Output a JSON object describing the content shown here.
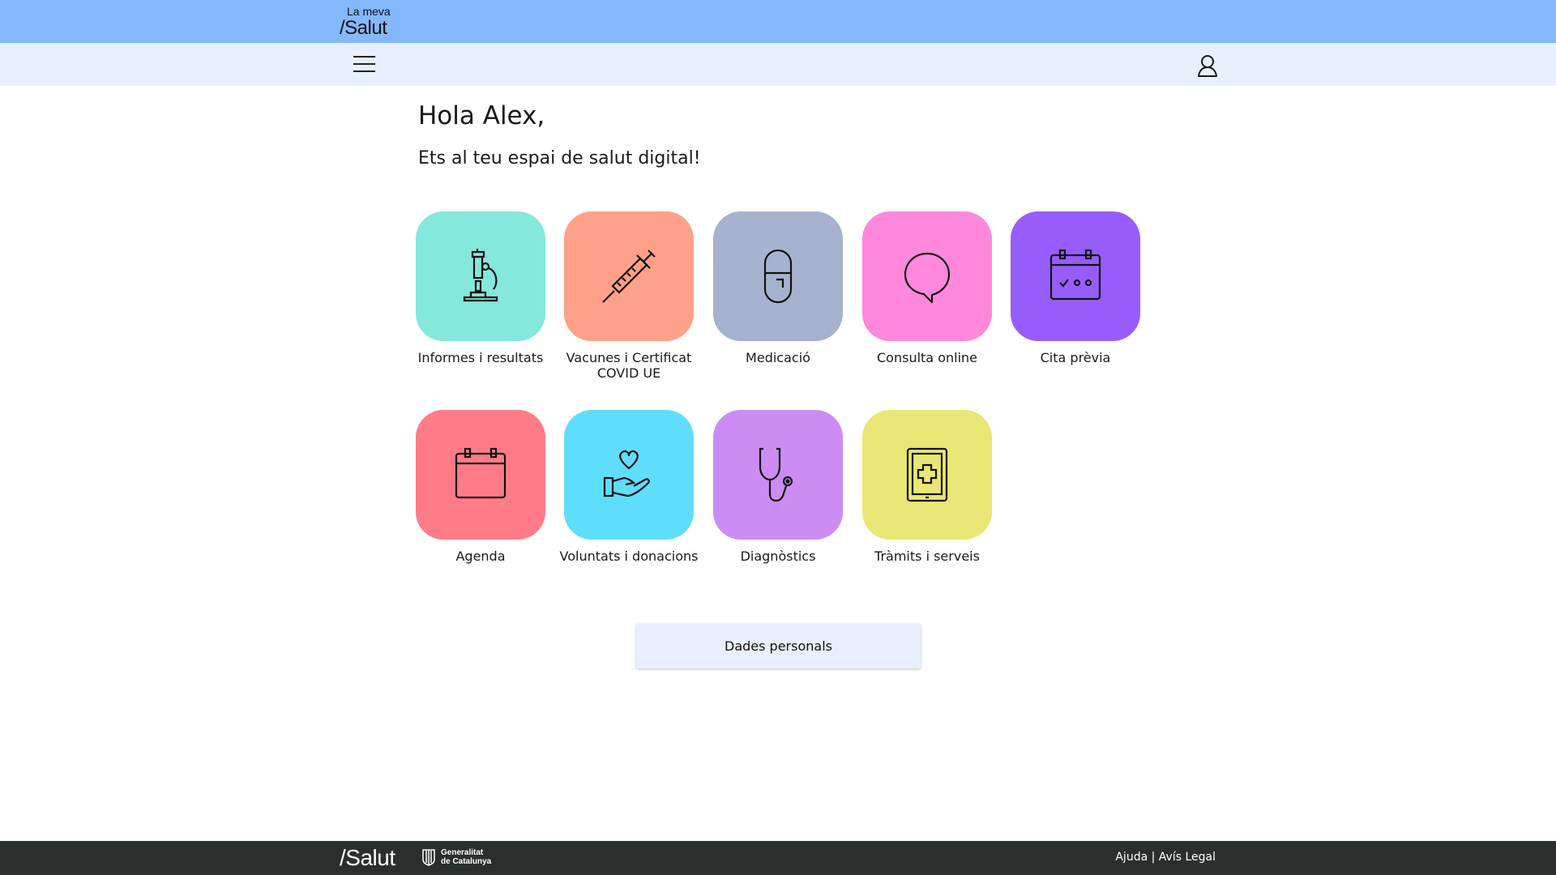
{
  "colors": {
    "top_bar": "#84b8fb",
    "nav_bar": "#e6f0fe",
    "footer": "#2a2f2e",
    "button": "#e9effc"
  },
  "header": {
    "logo_small": "La meva",
    "logo_big": "/Salut",
    "menu_icon": "hamburger-menu-icon",
    "user_icon": "user-icon"
  },
  "main": {
    "greeting": "Hola Alex,",
    "subtitle": "Ets al teu espai de salut digital!",
    "tiles": [
      {
        "label": "Informes i resultats",
        "color": "#84e8da",
        "icon": "microscope-icon"
      },
      {
        "label": "Vacunes i Certificat COVID UE",
        "color": "#ffa188",
        "icon": "syringe-icon"
      },
      {
        "label": "Medicació",
        "color": "#a7b2ce",
        "icon": "pill-icon"
      },
      {
        "label": "Consulta online",
        "color": "#ff88dc",
        "icon": "chat-bubble-icon"
      },
      {
        "label": "Cita prèvia",
        "color": "#965dfb",
        "icon": "calendar-check-icon"
      },
      {
        "label": "Agenda",
        "color": "#ff7b88",
        "icon": "calendar-icon"
      },
      {
        "label": "Voluntats i donacions",
        "color": "#5fdefc",
        "icon": "hand-heart-icon"
      },
      {
        "label": "Diagnòstics",
        "color": "#cd8cf3",
        "icon": "stethoscope-icon"
      },
      {
        "label": "Tràmits i serveis",
        "color": "#e9e775",
        "icon": "tablet-plus-icon"
      }
    ],
    "personal_data_button": "Dades personals"
  },
  "footer": {
    "logo": "/Salut",
    "gen_line1": "Generalitat",
    "gen_line2": "de Catalunya",
    "help": "Ajuda",
    "separator": "|",
    "legal": "Avís Legal"
  }
}
